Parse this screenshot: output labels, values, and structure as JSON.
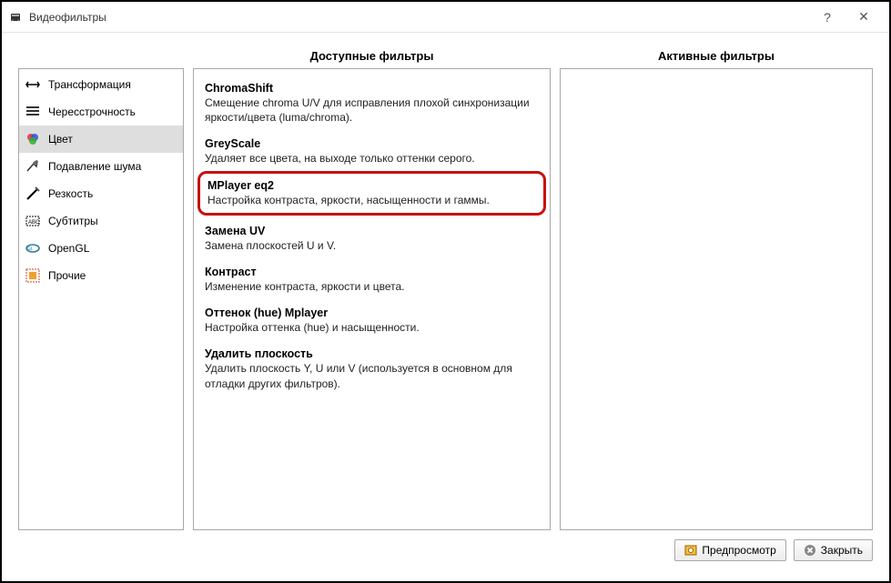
{
  "window": {
    "title": "Видеофильтры"
  },
  "headers": {
    "available": "Доступные фильтры",
    "active": "Активные фильтры"
  },
  "categories": [
    {
      "label": "Трансформация",
      "icon": "transform-icon"
    },
    {
      "label": "Чересстрочность",
      "icon": "interlace-icon"
    },
    {
      "label": "Цвет",
      "icon": "color-icon",
      "selected": true
    },
    {
      "label": "Подавление шума",
      "icon": "denoise-icon"
    },
    {
      "label": "Резкость",
      "icon": "sharpness-icon"
    },
    {
      "label": "Субтитры",
      "icon": "subtitles-icon"
    },
    {
      "label": "OpenGL",
      "icon": "opengl-icon"
    },
    {
      "label": "Прочие",
      "icon": "misc-icon"
    }
  ],
  "filters": [
    {
      "name": "ChromaShift",
      "desc": "Смещение chroma U/V для исправления плохой синхронизации яркости/цвета (luma/chroma)."
    },
    {
      "name": "GreyScale",
      "desc": "Удаляет все цвета, на выходе только оттенки серого."
    },
    {
      "name": "MPlayer eq2",
      "desc": "Настройка контраста, яркости, насыщенности и гаммы.",
      "highlighted": true
    },
    {
      "name": "Замена UV",
      "desc": "Замена плоскостей U и V."
    },
    {
      "name": "Контраст",
      "desc": "Изменение контраста, яркости и цвета."
    },
    {
      "name": "Оттенок (hue) Mplayer",
      "desc": "Настройка оттенка (hue) и насыщенности."
    },
    {
      "name": "Удалить плоскость",
      "desc": "Удалить плоскость Y, U или V (используется в основном для отладки других фильтров)."
    }
  ],
  "buttons": {
    "preview": "Предпросмотр",
    "close": "Закрыть"
  }
}
